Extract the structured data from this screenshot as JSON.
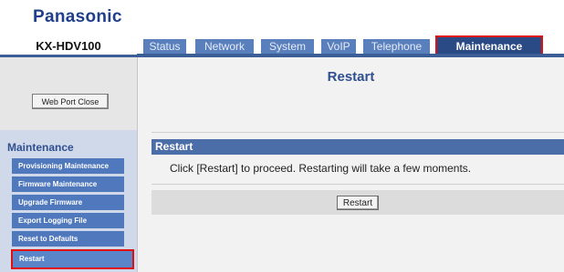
{
  "brand": "Panasonic",
  "model": "KX-HDV100",
  "tabs": [
    {
      "label": "Status"
    },
    {
      "label": "Network"
    },
    {
      "label": "System"
    },
    {
      "label": "VoIP"
    },
    {
      "label": "Telephone"
    },
    {
      "label": "Maintenance",
      "active": true
    }
  ],
  "sidebar": {
    "web_port_close": "Web Port Close",
    "heading": "Maintenance",
    "items": [
      {
        "label": "Provisioning Maintenance"
      },
      {
        "label": "Firmware Maintenance"
      },
      {
        "label": "Upgrade Firmware"
      },
      {
        "label": "Export Logging File"
      },
      {
        "label": "Reset to Defaults"
      },
      {
        "label": "Restart",
        "active": true
      }
    ]
  },
  "main": {
    "title": "Restart",
    "section_title": "Restart",
    "message": "Click [Restart] to proceed. Restarting will take a few moments.",
    "restart_button": "Restart"
  },
  "colors": {
    "brand": "#1f3f8a",
    "tab": "#5a7fbd",
    "tab_active": "#2a4a86",
    "highlight": "#e01010"
  }
}
